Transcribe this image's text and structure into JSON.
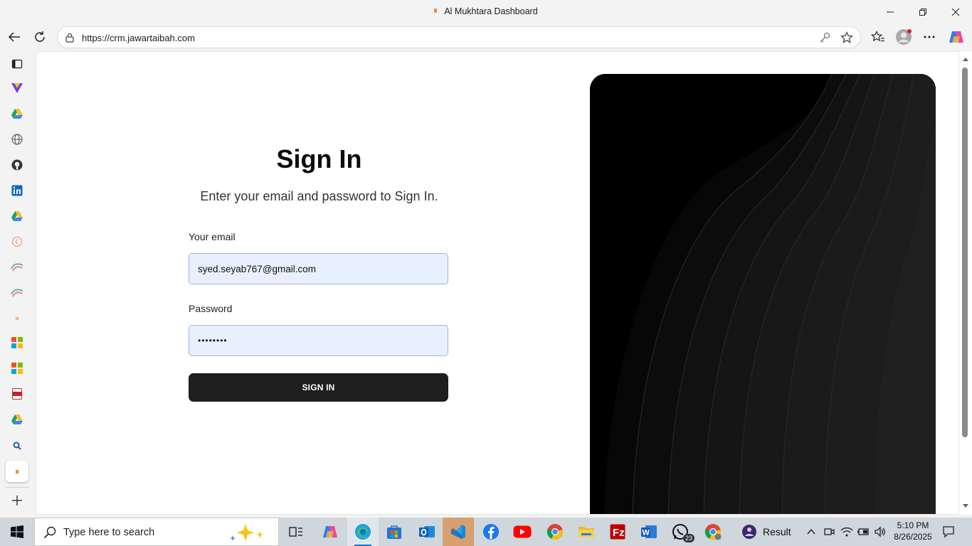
{
  "window": {
    "title": "Al Mukhtara Dashboard"
  },
  "browser": {
    "url": "https://crm.jawartaibah.com"
  },
  "signin": {
    "title": "Sign In",
    "subtitle": "Enter your email and password to Sign In.",
    "email_label": "Your email",
    "email_value": "syed.seyab767@gmail.com",
    "password_label": "Password",
    "password_value": "••••••••",
    "button_label": "SIGN IN"
  },
  "taskbar": {
    "search_placeholder": "Type here to search",
    "whatsapp_badge": "23",
    "result_label": "Result",
    "time": "5:10 PM",
    "date": "8/26/2025"
  },
  "colors": {
    "button": "#1e1e1e",
    "field_bg": "#e8f0fe",
    "hero_bg": "#000000"
  }
}
